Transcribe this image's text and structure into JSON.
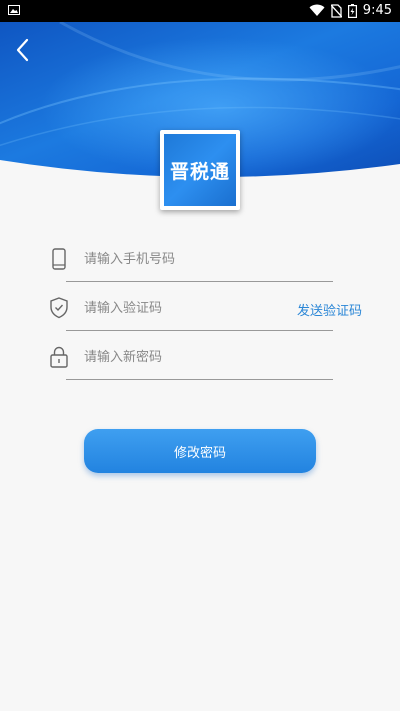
{
  "status_bar": {
    "time": "9:45",
    "icons": [
      "image-icon",
      "wifi-icon",
      "no-sim-icon",
      "battery-icon"
    ]
  },
  "header": {
    "back_icon": "chevron-left-icon"
  },
  "logo": {
    "text": "晋税通",
    "color": "#2d8ff0"
  },
  "form": {
    "phone": {
      "icon": "phone-icon",
      "placeholder": "请输入手机号码",
      "value": ""
    },
    "code": {
      "icon": "shield-check-icon",
      "placeholder": "请输入验证码",
      "value": "",
      "send_label": "发送验证码"
    },
    "password": {
      "icon": "lock-icon",
      "placeholder": "请输入新密码",
      "value": ""
    }
  },
  "submit": {
    "label": "修改密码"
  },
  "colors": {
    "accent": "#2a86d6",
    "button_top": "#3f9ff0",
    "button_bottom": "#2283e0",
    "header_blue": "#1a6fd6"
  }
}
